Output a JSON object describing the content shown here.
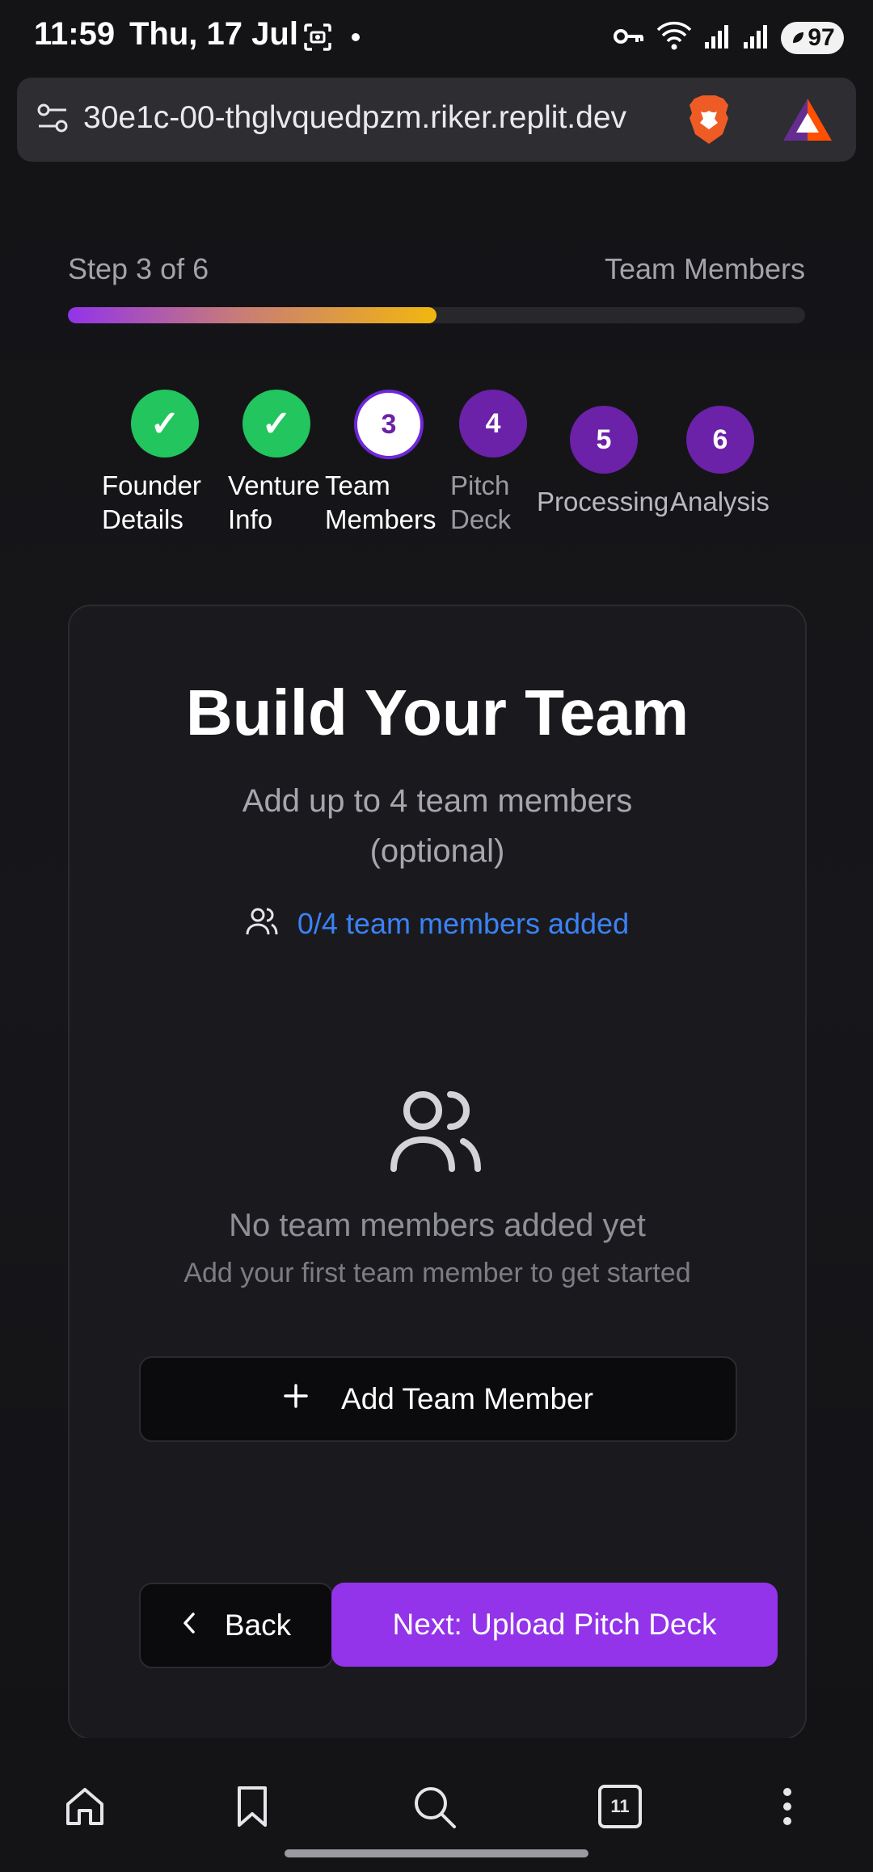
{
  "status_bar": {
    "time": "11:59",
    "date": "Thu, 17 Jul",
    "battery": "97",
    "icons": [
      "screenshot-icon",
      "dot-icon",
      "vpn-key-icon",
      "wifi-icon",
      "signal-icon",
      "signal-icon",
      "battery-saver-icon"
    ]
  },
  "browser": {
    "url": "30e1c-00-thglvquedpzm.riker.replit.dev",
    "tab_count": "11"
  },
  "progress": {
    "step_label": "Step 3 of 6",
    "step_name": "Team Members",
    "percent": 50,
    "gradient": [
      "#9333ea",
      "#f2b70f"
    ]
  },
  "stepper": [
    {
      "mark": "✓",
      "line1": "Founder",
      "line2": "Details",
      "state": "done"
    },
    {
      "mark": "✓",
      "line1": "Venture",
      "line2": "Info",
      "state": "done"
    },
    {
      "mark": "3",
      "line1": "Team",
      "line2": "Members",
      "state": "active"
    },
    {
      "mark": "4",
      "line1": "Pitch",
      "line2": "Deck",
      "state": "todo"
    },
    {
      "mark": "5",
      "line1": "Processing",
      "line2": "",
      "state": "todo"
    },
    {
      "mark": "6",
      "line1": "Analysis",
      "line2": "",
      "state": "todo"
    }
  ],
  "card": {
    "title": "Build Your Team",
    "subtitle": "Add up to 4 team members (optional)",
    "count_text": "0/4 team members added",
    "empty_title": "No team members added yet",
    "empty_subtitle": "Add your first team member to get started",
    "add_button": "Add Team Member",
    "back_button": "Back",
    "next_button": "Next: Upload Pitch Deck"
  },
  "colors": {
    "accent": "#9333ea",
    "success": "#22c55e",
    "link": "#3b82f6",
    "step_todo": "#6b21a8"
  },
  "bottom_nav": [
    "home-icon",
    "bookmark-icon",
    "search-icon",
    "tabs-icon",
    "more-menu-icon"
  ]
}
